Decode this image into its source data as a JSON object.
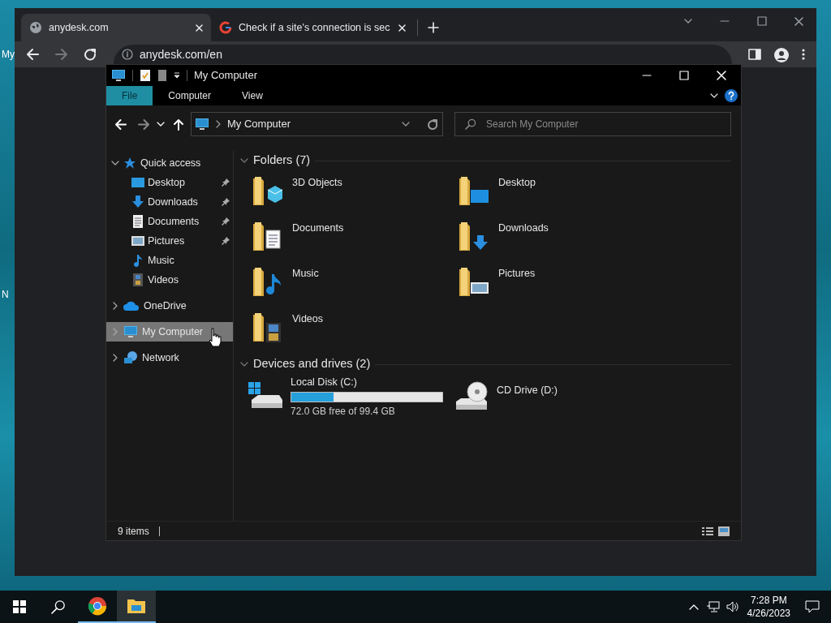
{
  "desktop_icons": [
    {
      "label": "My"
    },
    {
      "label": "N"
    }
  ],
  "browser": {
    "tabs": [
      {
        "title": "anydesk.com",
        "selected": true
      },
      {
        "title": "Check if a site's connection is sec",
        "selected": false
      }
    ],
    "address": "anydesk.com/en"
  },
  "explorer": {
    "title": "My Computer",
    "ribbon_tabs": [
      {
        "label": "File",
        "selected": true
      },
      {
        "label": "Computer",
        "selected": false
      },
      {
        "label": "View",
        "selected": false
      }
    ],
    "address_path": "My Computer",
    "search": {
      "placeholder": "Search My Computer"
    },
    "sidebar": [
      {
        "label": "Quick access",
        "expanded": true,
        "selected": false,
        "children": [
          {
            "label": "Desktop",
            "pinned": true
          },
          {
            "label": "Downloads",
            "pinned": true
          },
          {
            "label": "Documents",
            "pinned": true
          },
          {
            "label": "Pictures",
            "pinned": true
          },
          {
            "label": "Music",
            "pinned": false
          },
          {
            "label": "Videos",
            "pinned": false
          }
        ]
      },
      {
        "label": "OneDrive",
        "expanded": false,
        "selected": false
      },
      {
        "label": "My Computer",
        "expanded": false,
        "selected": true
      },
      {
        "label": "Network",
        "expanded": false,
        "selected": false
      }
    ],
    "groups": [
      {
        "title": "Folders (7)",
        "expanded": true,
        "items": [
          {
            "kind": "folder",
            "name": "3D Objects"
          },
          {
            "kind": "folder",
            "name": "Desktop"
          },
          {
            "kind": "folder",
            "name": "Documents"
          },
          {
            "kind": "folder",
            "name": "Downloads"
          },
          {
            "kind": "folder",
            "name": "Music"
          },
          {
            "kind": "folder",
            "name": "Pictures"
          },
          {
            "kind": "folder",
            "name": "Videos"
          }
        ]
      },
      {
        "title": "Devices and drives (2)",
        "expanded": true,
        "items": [
          {
            "kind": "disk",
            "name": "Local Disk (C:)",
            "level": 0.28,
            "free": "72.0 GB free of 99.4 GB"
          },
          {
            "kind": "cd",
            "name": "CD Drive (D:)"
          }
        ]
      }
    ],
    "status": "9 items"
  },
  "taskbar": {
    "apps": [
      {
        "selected": false
      },
      {
        "selected": true
      }
    ],
    "time": "7:28 PM",
    "date": "4/26/2023"
  }
}
